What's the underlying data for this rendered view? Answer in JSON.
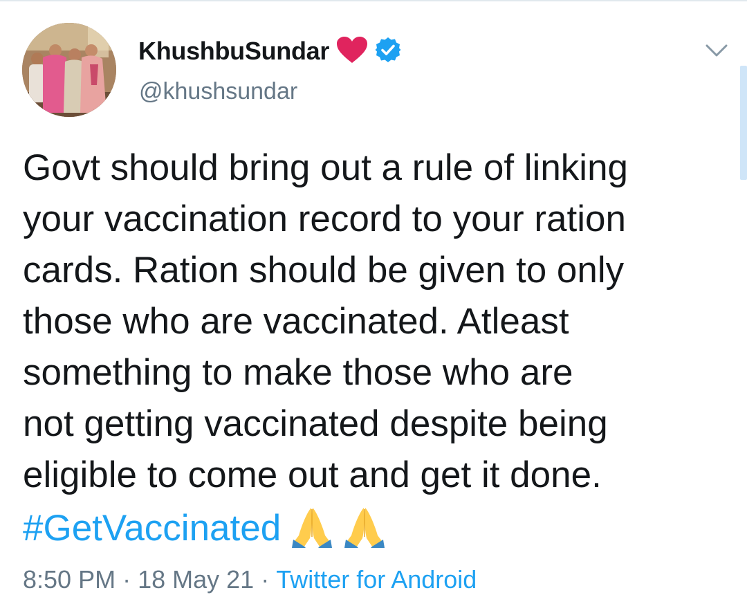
{
  "tweet": {
    "display_name": "KhushbuSundar",
    "handle": "@khushsundar",
    "text_lines": [
      "Govt should bring out a rule of linking",
      "your vaccination record to your ration",
      "cards. Ration should be given to only",
      "those who are vaccinated. Atleast",
      "something to make those who are",
      "not getting vaccinated despite being",
      "eligible to come out and get it done."
    ],
    "hashtag": "#GetVaccinated",
    "emojis": [
      "folded-hands",
      "folded-hands"
    ],
    "time": "8:50 PM",
    "date": "18 May 21",
    "separator": "·",
    "source": "Twitter for Android"
  },
  "icons": {
    "name_emoji": "red-heart",
    "verified": "verified-badge",
    "menu": "chevron-down"
  },
  "colors": {
    "link": "#1da1f2",
    "secondary_text": "#657786",
    "heart": "#e0245e",
    "verified": "#1da1f2"
  }
}
